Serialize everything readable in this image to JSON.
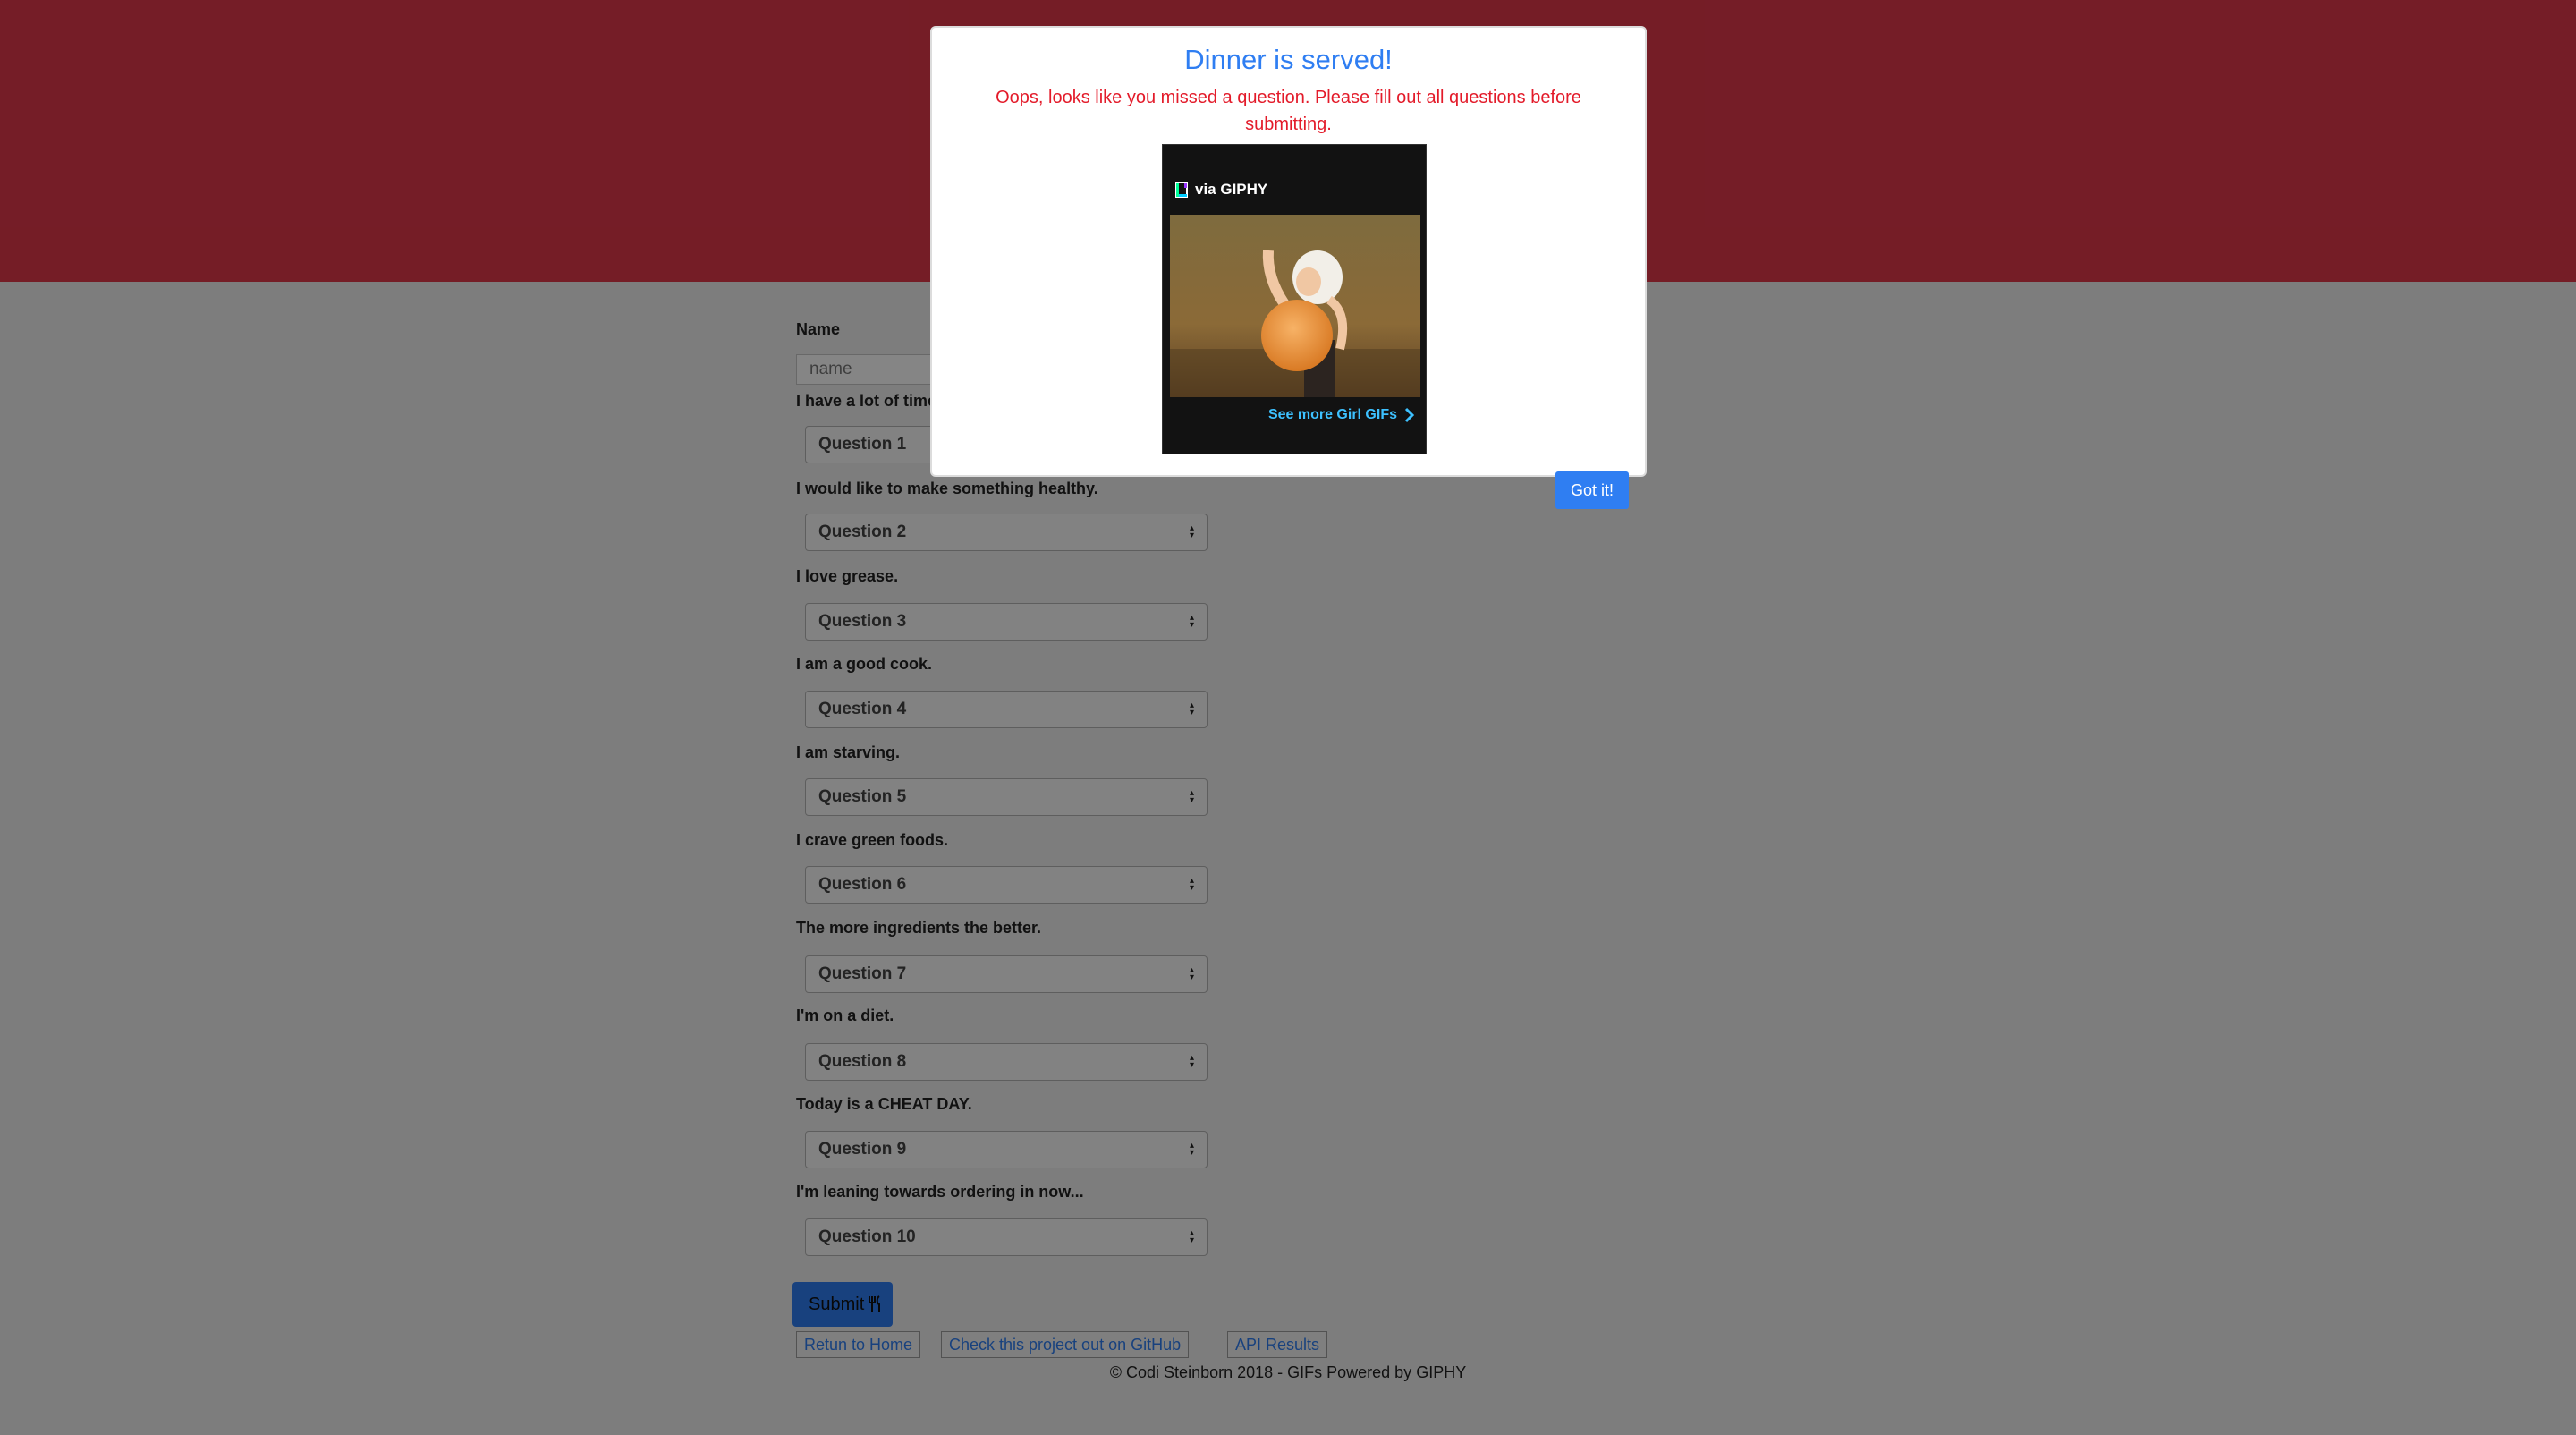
{
  "form": {
    "name_label": "Name",
    "name_placeholder": "name",
    "questions": [
      {
        "text": "I have a lot of time to cook.",
        "select": "Question 1"
      },
      {
        "text": "I would like to make something healthy.",
        "select": "Question 2"
      },
      {
        "text": "I love grease.",
        "select": "Question 3"
      },
      {
        "text": "I am a good cook.",
        "select": "Question 4"
      },
      {
        "text": "I am starving.",
        "select": "Question 5"
      },
      {
        "text": "I crave green foods.",
        "select": "Question 6"
      },
      {
        "text": "The more ingredients the better.",
        "select": "Question 7"
      },
      {
        "text": "I'm on a diet.",
        "select": "Question 8"
      },
      {
        "text": "Today is a CHEAT DAY.",
        "select": "Question 9"
      },
      {
        "text": "I'm leaning towards ordering in now...",
        "select": "Question 10"
      }
    ],
    "submit_label": "Submit"
  },
  "links": {
    "home": "Retun to Home",
    "github": "Check this project out on GitHub",
    "api": "API Results"
  },
  "footer": {
    "text": "© Codi Steinborn 2018 - GIFs Powered by GIPHY"
  },
  "modal": {
    "title": "Dinner is served!",
    "message": "Oops, looks like you missed a question. Please fill out all questions before submitting.",
    "giphy_via": "via GIPHY",
    "giphy_more": "See more Girl GIFs",
    "ok_label": "Got it!"
  },
  "colors": {
    "header": "#e0384a",
    "accent": "#2f7ef2",
    "error": "#e31b2a"
  }
}
